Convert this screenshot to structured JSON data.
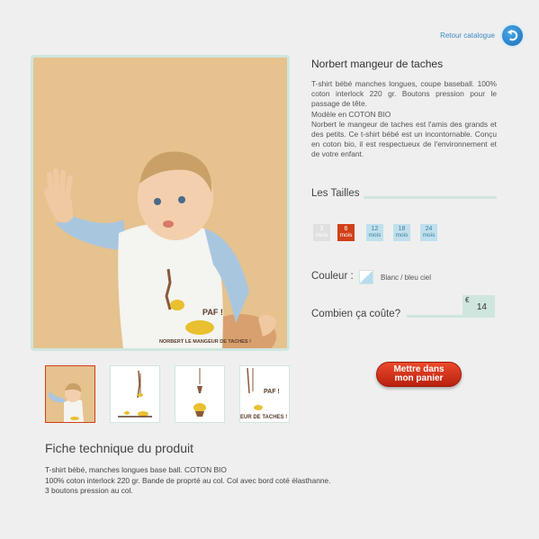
{
  "header": {
    "retour_label": "Retour catalogue",
    "retour_icon": "back-arrow-icon"
  },
  "product": {
    "title": "Norbert mangeur de taches",
    "description": [
      "T-shirt bébé manches longues,  coupe baseball. 100% coton interlock 220 gr. Boutons pression pour le passage de tête.",
      "Modèle en COTON BIO",
      "Norbert le mangeur de taches est l'amis des grands et des petits. Ce t-shirt bébé est un incontornable. Conçu en coton bio, il est respectueux de l'environnement et de votre enfant."
    ],
    "print_text_1": "PAF !",
    "print_text_2": "NORBERT LE MANGEUR DE TACHES !"
  },
  "sizes": {
    "title": "Les Tailles",
    "items": [
      {
        "num": "3",
        "unit": "mois",
        "state": "disabled"
      },
      {
        "num": "6",
        "unit": "mois",
        "state": "selected"
      },
      {
        "num": "12",
        "unit": "mois",
        "state": "normal"
      },
      {
        "num": "18",
        "unit": "mois",
        "state": "normal"
      },
      {
        "num": "24",
        "unit": "mois",
        "state": "normal"
      }
    ]
  },
  "color": {
    "title": "Couleur :",
    "value": "Blanc / bleu ciel"
  },
  "price": {
    "title": "Combien ça coûte?",
    "currency": "€",
    "value": "14"
  },
  "cart": {
    "line1": "Mettre dans",
    "line2": "mon panier"
  },
  "fiche": {
    "title": "Fiche technique du produit",
    "lines": [
      "T-shirt bébé, manches longues base ball. COTON BIO",
      "100% coton interlock 220 gr. Bande de proprté au col. Col avec bord coté élasthanne.",
      "3 boutons pression au col."
    ]
  },
  "colors": {
    "accent_line": "#cfe6df",
    "selected": "#d0401a",
    "link": "#3a8bc7"
  }
}
